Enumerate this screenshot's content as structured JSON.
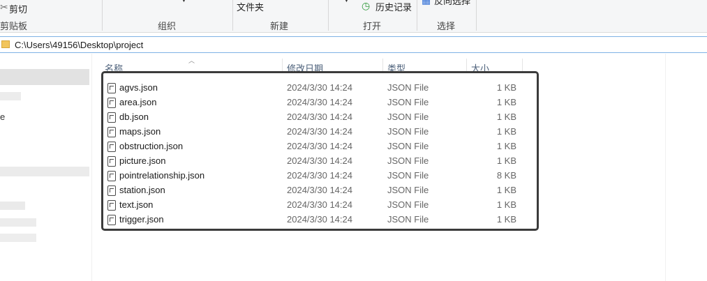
{
  "ribbon": {
    "cut_label": "剪切",
    "clipboard_group": "剪贴板",
    "organize_group": "组织",
    "folder_label": "文件夹",
    "new_group": "新建",
    "history_label": "历史记录",
    "open_group": "打开",
    "invert_select_label": "反向选择",
    "select_group": "选择"
  },
  "address": {
    "path": "C:\\Users\\49156\\Desktop\\project"
  },
  "columns": {
    "name": "名称",
    "date": "修改日期",
    "type": "类型",
    "size": "大小"
  },
  "files": [
    {
      "name": "agvs.json",
      "date": "2024/3/30 14:24",
      "type": "JSON File",
      "size": "1 KB"
    },
    {
      "name": "area.json",
      "date": "2024/3/30 14:24",
      "type": "JSON File",
      "size": "1 KB"
    },
    {
      "name": "db.json",
      "date": "2024/3/30 14:24",
      "type": "JSON File",
      "size": "1 KB"
    },
    {
      "name": "maps.json",
      "date": "2024/3/30 14:24",
      "type": "JSON File",
      "size": "1 KB"
    },
    {
      "name": "obstruction.json",
      "date": "2024/3/30 14:24",
      "type": "JSON File",
      "size": "1 KB"
    },
    {
      "name": "picture.json",
      "date": "2024/3/30 14:24",
      "type": "JSON File",
      "size": "1 KB"
    },
    {
      "name": "pointrelationship.json",
      "date": "2024/3/30 14:24",
      "type": "JSON File",
      "size": "8 KB"
    },
    {
      "name": "station.json",
      "date": "2024/3/30 14:24",
      "type": "JSON File",
      "size": "1 KB"
    },
    {
      "name": "text.json",
      "date": "2024/3/30 14:24",
      "type": "JSON File",
      "size": "1 KB"
    },
    {
      "name": "trigger.json",
      "date": "2024/3/30 14:24",
      "type": "JSON File",
      "size": "1 KB"
    }
  ],
  "nav": {
    "partial_label": "e"
  }
}
